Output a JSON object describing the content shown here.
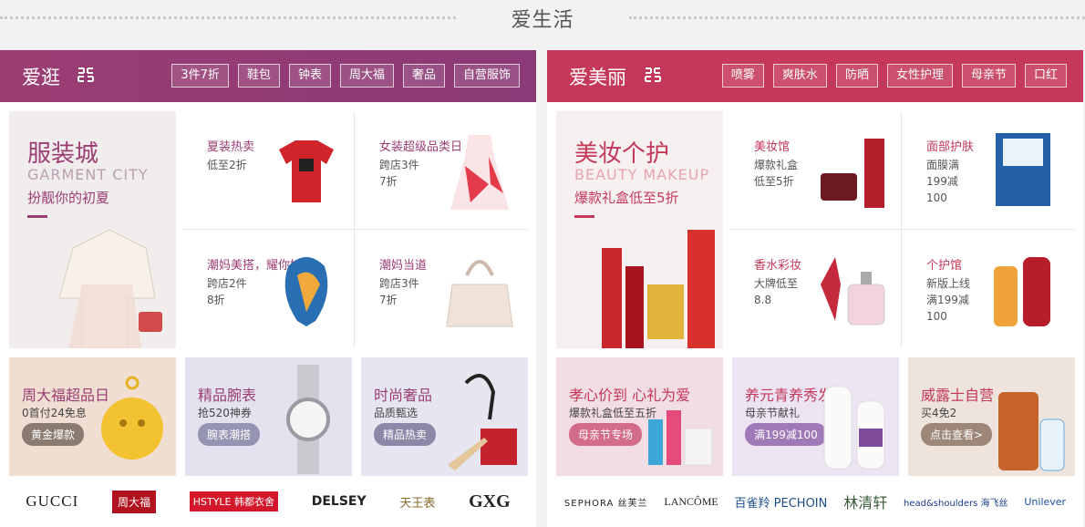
{
  "top_title": "爱生活",
  "left": {
    "title": "爱逛",
    "tags": [
      "3件7折",
      "鞋包",
      "钟表",
      "周大福",
      "奢品",
      "自营服饰"
    ],
    "hero": {
      "title": "服装城",
      "en": "GARMENT CITY",
      "sub": "扮靓你的初夏"
    },
    "cells": [
      {
        "title": "夏装热卖",
        "desc": "低至2折"
      },
      {
        "title": "女装超级品类日",
        "desc": "跨店3件\n7折"
      },
      {
        "title": "潮妈美搭，耀你好看",
        "desc": "跨店2件\n8折"
      },
      {
        "title": "潮妈当道",
        "desc": "跨店3件\n7折"
      }
    ],
    "promos": [
      {
        "title": "周大福超品日",
        "sub": "0首付24免息",
        "btn": "黄金爆款",
        "bg": "#f0ded2",
        "btnbg": "#8a7a70"
      },
      {
        "title": "精品腕表",
        "sub": "抢520神券",
        "btn": "腕表潮搭",
        "bg": "#e3e2ee",
        "btnbg": "#9694b3"
      },
      {
        "title": "时尚奢品",
        "sub": "品质甄选",
        "btn": "精品热卖",
        "bg": "#e6e6f0",
        "btnbg": "#8b88a8"
      }
    ],
    "brands": [
      "GUCCI",
      "周大福",
      "HSTYLE 韩都衣舍",
      "DELSEY",
      "天王表",
      "GXG"
    ]
  },
  "right": {
    "title": "爱美丽",
    "tags": [
      "喷雾",
      "爽肤水",
      "防晒",
      "女性护理",
      "母亲节",
      "口红"
    ],
    "hero": {
      "title": "美妆个护",
      "en": "BEAUTY MAKEUP",
      "sub": "爆款礼盒低至5折"
    },
    "cells": [
      {
        "title": "美妆馆",
        "desc": "爆款礼盒\n低至5折"
      },
      {
        "title": "面部护肤",
        "desc": "面膜满\n199减\n100"
      },
      {
        "title": "香水彩妆",
        "desc": "大牌低至\n8.8"
      },
      {
        "title": "个护馆",
        "desc": "新版上线\n满199减\n100"
      }
    ],
    "promos": [
      {
        "title": "孝心价到 心礼为爱",
        "sub": "爆款礼盒低至五折",
        "btn": "母亲节专场",
        "bg": "#f2dde4",
        "btnbg": "#d36b8a"
      },
      {
        "title": "养元青养秀发",
        "sub": "母亲节献礼",
        "btn": "满199减100",
        "bg": "#ece4f2",
        "btnbg": "#a07ab8"
      },
      {
        "title": "威露士自营",
        "sub": "买4免2",
        "btn": "点击查看>",
        "bg": "#efe4dc",
        "btnbg": "#9c8779"
      }
    ],
    "brands": [
      "SEPHORA 丝芙兰",
      "LANCÔME",
      "百雀羚 PECHOIN",
      "林清轩",
      "head&shoulders 海飞丝",
      "Unilever"
    ]
  }
}
